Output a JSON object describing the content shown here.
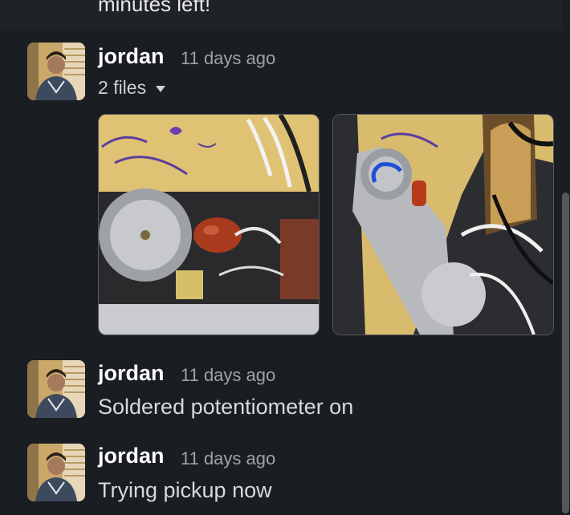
{
  "previous_message": {
    "text": "minutes left!"
  },
  "messages": [
    {
      "sender": "jordan",
      "timestamp": "11 days ago",
      "files_label": "2 files",
      "icon": "chevron-down-icon"
    },
    {
      "sender": "jordan",
      "timestamp": "11 days ago",
      "text": "Soldered potentiometer on"
    },
    {
      "sender": "jordan",
      "timestamp": "11 days ago",
      "text": "Trying pickup now"
    }
  ],
  "colors": {
    "background": "#1a1d21",
    "sender": "#ffffff",
    "timestamp": "#a0a2a5",
    "body_text": "#d8d9da"
  }
}
